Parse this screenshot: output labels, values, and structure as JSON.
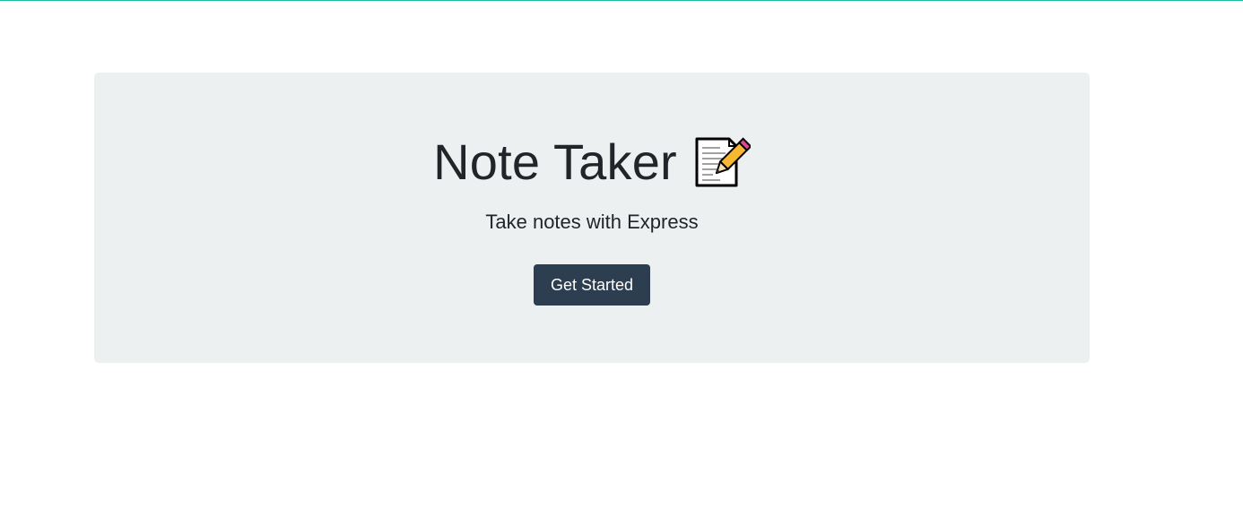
{
  "header": {
    "title": "Note Taker",
    "title_icon": "memo-icon",
    "subtitle": "Take notes with Express"
  },
  "actions": {
    "get_started_label": "Get Started"
  },
  "colors": {
    "accent_line": "#18bc9c",
    "jumbotron_bg": "#ecf0f1",
    "button_bg": "#2c3e50",
    "text": "#212529"
  }
}
